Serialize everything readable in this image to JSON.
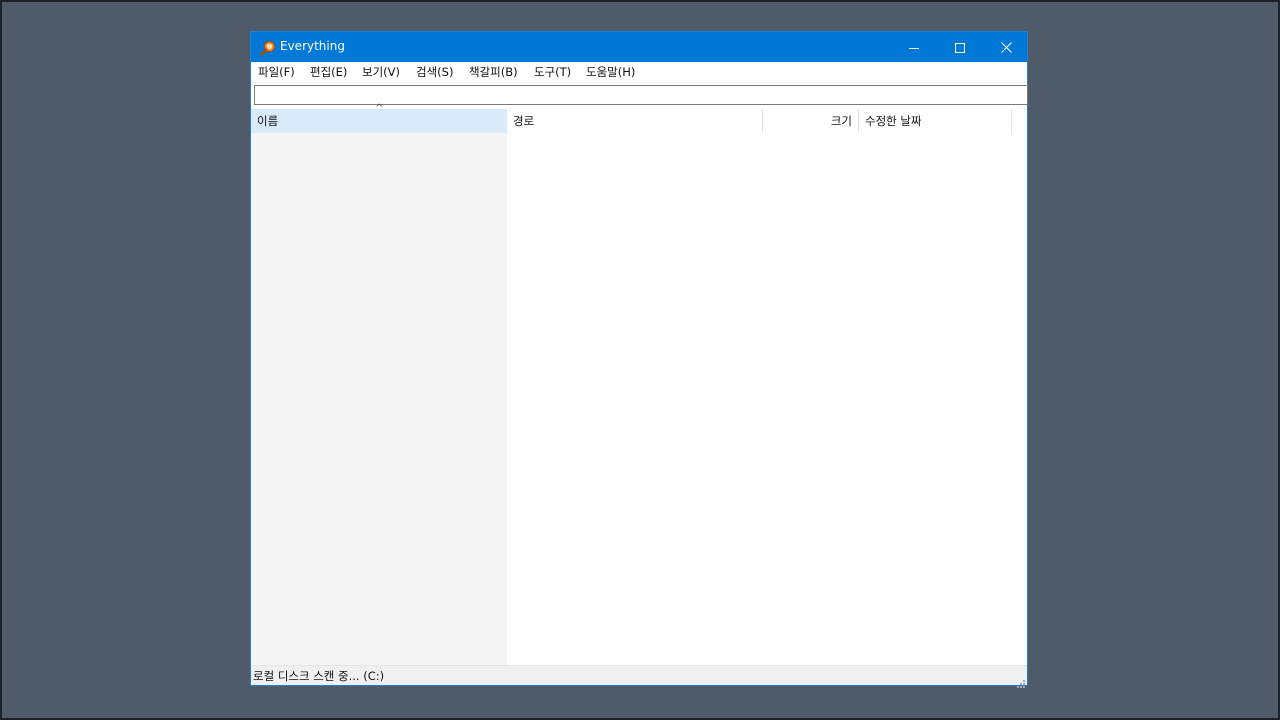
{
  "window": {
    "title": "Everything",
    "accent_color": "#0078d7",
    "icon": "magnifier-icon",
    "controls": {
      "minimize": "minimize-icon",
      "maximize": "maximize-icon",
      "close": "close-icon"
    }
  },
  "menu": [
    {
      "label": "파일(F)"
    },
    {
      "label": "편집(E)"
    },
    {
      "label": "보기(V)"
    },
    {
      "label": "검색(S)"
    },
    {
      "label": "책갈피(B)"
    },
    {
      "label": "도구(T)"
    },
    {
      "label": "도움말(H)"
    }
  ],
  "search": {
    "value": "",
    "placeholder": ""
  },
  "columns": {
    "name": "이름",
    "path": "경로",
    "size": "크기",
    "date_modified": "수정한 날짜",
    "sort_indicator": "^"
  },
  "rows": [],
  "status": {
    "text": "로컬 디스크 스캔 중... (C:)"
  }
}
